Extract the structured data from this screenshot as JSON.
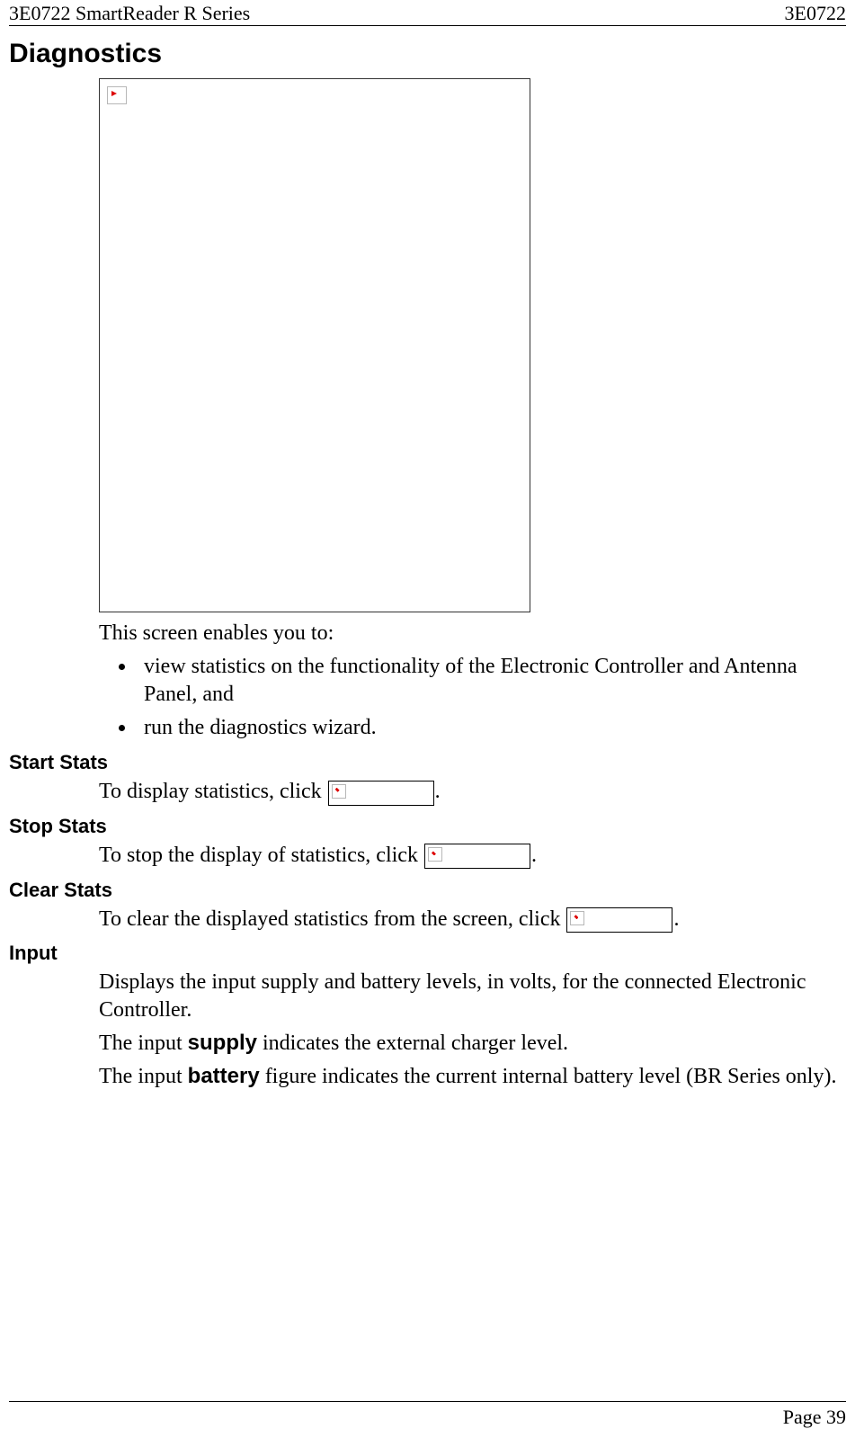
{
  "header": {
    "left": "3E0722 SmartReader R Series",
    "right": "3E0722"
  },
  "title": "Diagnostics",
  "intro": "This screen enables you to:",
  "bullets": [
    "view statistics on the functionality of the Electronic Controller and Antenna Panel, and",
    "run the diagnostics wizard."
  ],
  "sections": {
    "start_stats": {
      "heading": "Start Stats",
      "text_before": "To display statistics, click ",
      "text_after": "."
    },
    "stop_stats": {
      "heading": "Stop Stats",
      "text_before": "To stop the display of statistics, click ",
      "text_after": "."
    },
    "clear_stats": {
      "heading": "Clear Stats",
      "text_before": "To clear the displayed statistics from the screen, click ",
      "text_after": "."
    },
    "input": {
      "heading": "Input",
      "p1": "Displays the input supply and battery levels, in volts, for the connected Electronic Controller.",
      "p2_before": "The input ",
      "p2_bold": "supply",
      "p2_after": " indicates the external charger level.",
      "p3_before": "The input ",
      "p3_bold": "battery",
      "p3_after": " figure indicates the current internal battery level (BR Series only)."
    }
  },
  "footer": "Page 39"
}
